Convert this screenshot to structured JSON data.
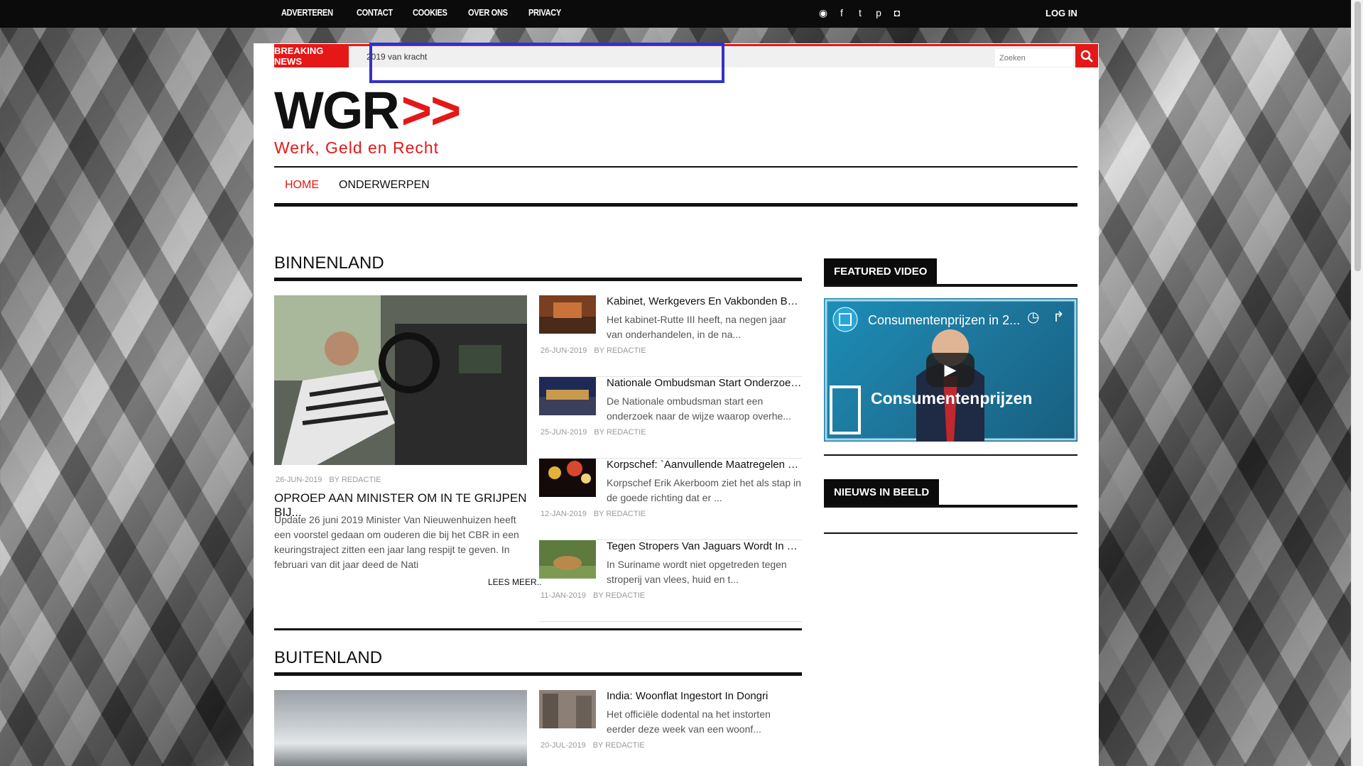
{
  "topnav": {
    "items": [
      "ADVERTEREN",
      "CONTACT",
      "COOKIES",
      "OVER ONS",
      "PRIVACY"
    ],
    "login": "LOG IN"
  },
  "social": {
    "icons": [
      "rss-icon",
      "facebook-icon",
      "twitter-icon",
      "pinterest-icon",
      "instagram-icon"
    ],
    "glyphs": [
      "◉",
      "f",
      "t",
      "p",
      "◘"
    ]
  },
  "breaking": {
    "label": "BREAKING NEWS",
    "ticker": "2019 van kracht",
    "search_placeholder": "Zoeken"
  },
  "logo": {
    "text": "WGR",
    "arrows": ">>",
    "subtitle": "Werk, Geld en Recht"
  },
  "mainnav": {
    "items": [
      "HOME",
      "ONDERWERPEN"
    ]
  },
  "binnenland": {
    "title": "BINNENLAND",
    "feature": {
      "date": "26-JUN-2019",
      "author": "BY REDACTIE",
      "title": "OPROEP AAN MINISTER OM IN TE GRIJPEN BIJ...",
      "text": "Update 26 juni 2019 Minister Van Nieuwenhuizen heeft een voorstel gedaan om ouderen die bij het CBR in een keuringstraject zitten een jaar lang respijt te geven. In februari van dit jaar deed de Nati",
      "readmore": "LEES MEER.."
    },
    "items": [
      {
        "title": "Kabinet, Werkgevers En Vakbonden Bereike...",
        "text": "Het kabinet-Rutte III heeft, na negen jaar van onderhandelen, in de na...",
        "date": "26-JUN-2019",
        "author": "BY REDACTIE"
      },
      {
        "title": "Nationale Ombudsman Start Onderzoek Naar...",
        "text": "De Nationale ombudsman start een onderzoek naar de wijze waarop overhe...",
        "date": "25-JUN-2019",
        "author": "BY REDACTIE"
      },
      {
        "title": "Korpschef: `Aanvullende Maatregelen Jaar...",
        "text": "Korpschef Erik Akerboom ziet het als stap in de goede richting dat er ...",
        "date": "12-JAN-2019",
        "author": "BY REDACTIE"
      },
      {
        "title": "Tegen Stropers Van Jaguars Wordt In Suri...",
        "text": "In Suriname wordt niet opgetreden tegen stroperij van vlees, huid en t...",
        "date": "11-JAN-2019",
        "author": "BY REDACTIE"
      }
    ]
  },
  "buitenland": {
    "title": "BUITENLAND",
    "items": [
      {
        "title": "India: Woonflat Ingestort In Dongri",
        "text": "Het officiële dodental na het instorten eerder deze week van een woonf...",
        "date": "20-JUL-2019",
        "author": "BY REDACTIE"
      }
    ]
  },
  "sidebar": {
    "featured_video": "FEATURED VIDEO",
    "video_title": "Consumentenprijzen in 2...",
    "video_brand": "Consumentenprijzen",
    "nieuws_in_beeld": "NIEUWS IN BEELD"
  },
  "colors": {
    "accent": "#e51717",
    "topbar": "#0b0b0b",
    "highlight": "#3232c8"
  }
}
